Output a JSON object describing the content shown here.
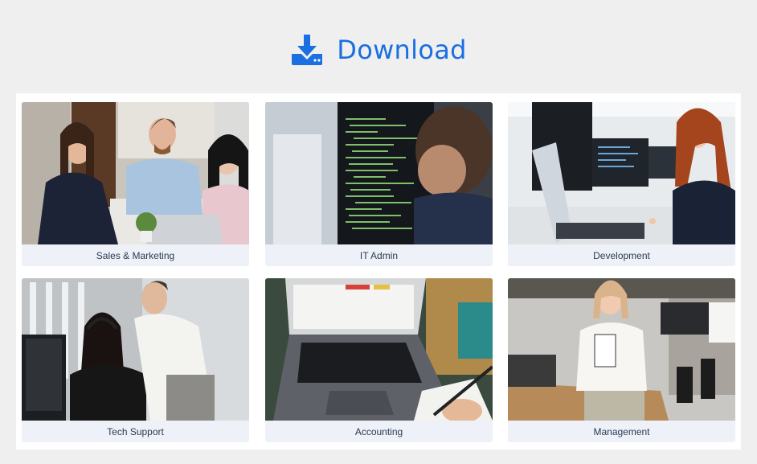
{
  "header": {
    "title": "Download",
    "icon": "download-icon",
    "accent_color": "#1b6fe0"
  },
  "cards": [
    {
      "label": "Sales & Marketing"
    },
    {
      "label": "IT Admin"
    },
    {
      "label": "Development"
    },
    {
      "label": "Tech Support"
    },
    {
      "label": "Accounting"
    },
    {
      "label": "Management"
    }
  ]
}
